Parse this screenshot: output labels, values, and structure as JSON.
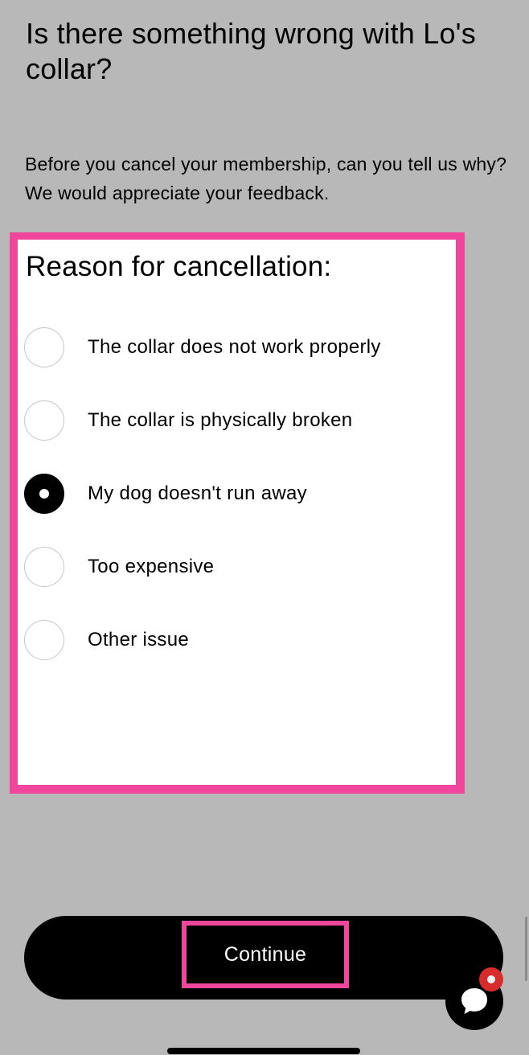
{
  "page": {
    "title": "Is there something wrong with Lo's collar?",
    "subtitle": "Before you cancel your membership, can you tell us why? We would appreciate your feedback."
  },
  "form": {
    "heading": "Reason for cancellation:",
    "options": [
      {
        "label": "The collar does not work properly",
        "selected": false
      },
      {
        "label": "The collar is physically broken",
        "selected": false
      },
      {
        "label": "My dog doesn't run away",
        "selected": true
      },
      {
        "label": "Too expensive",
        "selected": false
      },
      {
        "label": "Other issue",
        "selected": false
      }
    ]
  },
  "actions": {
    "continue_label": "Continue"
  },
  "icons": {
    "chat": "chat-bubble-icon",
    "notification": "notification-dot"
  },
  "colors": {
    "background": "#b8b8b8",
    "highlight": "#f0469b",
    "button": "#000000",
    "notification": "#d72c2c"
  }
}
